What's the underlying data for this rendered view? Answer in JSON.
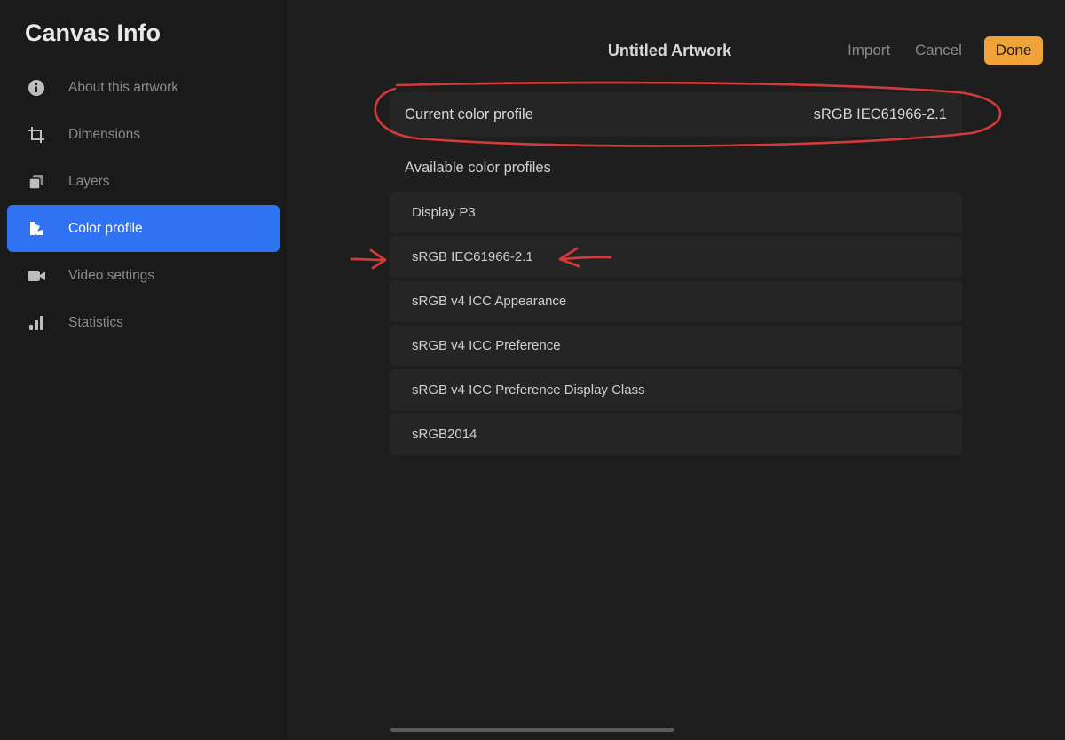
{
  "sidebar": {
    "title": "Canvas Info",
    "items": [
      {
        "label": "About this artwork",
        "icon": "info-icon"
      },
      {
        "label": "Dimensions",
        "icon": "crop-icon"
      },
      {
        "label": "Layers",
        "icon": "layers-icon"
      },
      {
        "label": "Color profile",
        "icon": "color-profile-icon",
        "active": true
      },
      {
        "label": "Video settings",
        "icon": "video-camera-icon"
      },
      {
        "label": "Statistics",
        "icon": "bar-chart-icon"
      }
    ]
  },
  "header": {
    "title": "Untitled Artwork",
    "import_label": "Import",
    "cancel_label": "Cancel",
    "done_label": "Done"
  },
  "current_profile": {
    "label": "Current color profile",
    "value": "sRGB IEC61966-2.1"
  },
  "available": {
    "label": "Available color profiles",
    "items": [
      "Display P3",
      "sRGB IEC61966-2.1",
      "sRGB v4 ICC Appearance",
      "sRGB v4 ICC Preference",
      "sRGB v4 ICC Preference Display Class",
      "sRGB2014"
    ]
  },
  "colors": {
    "accent": "#2f72f2",
    "done_button": "#f0a23a",
    "annotation": "#d33a3a"
  }
}
